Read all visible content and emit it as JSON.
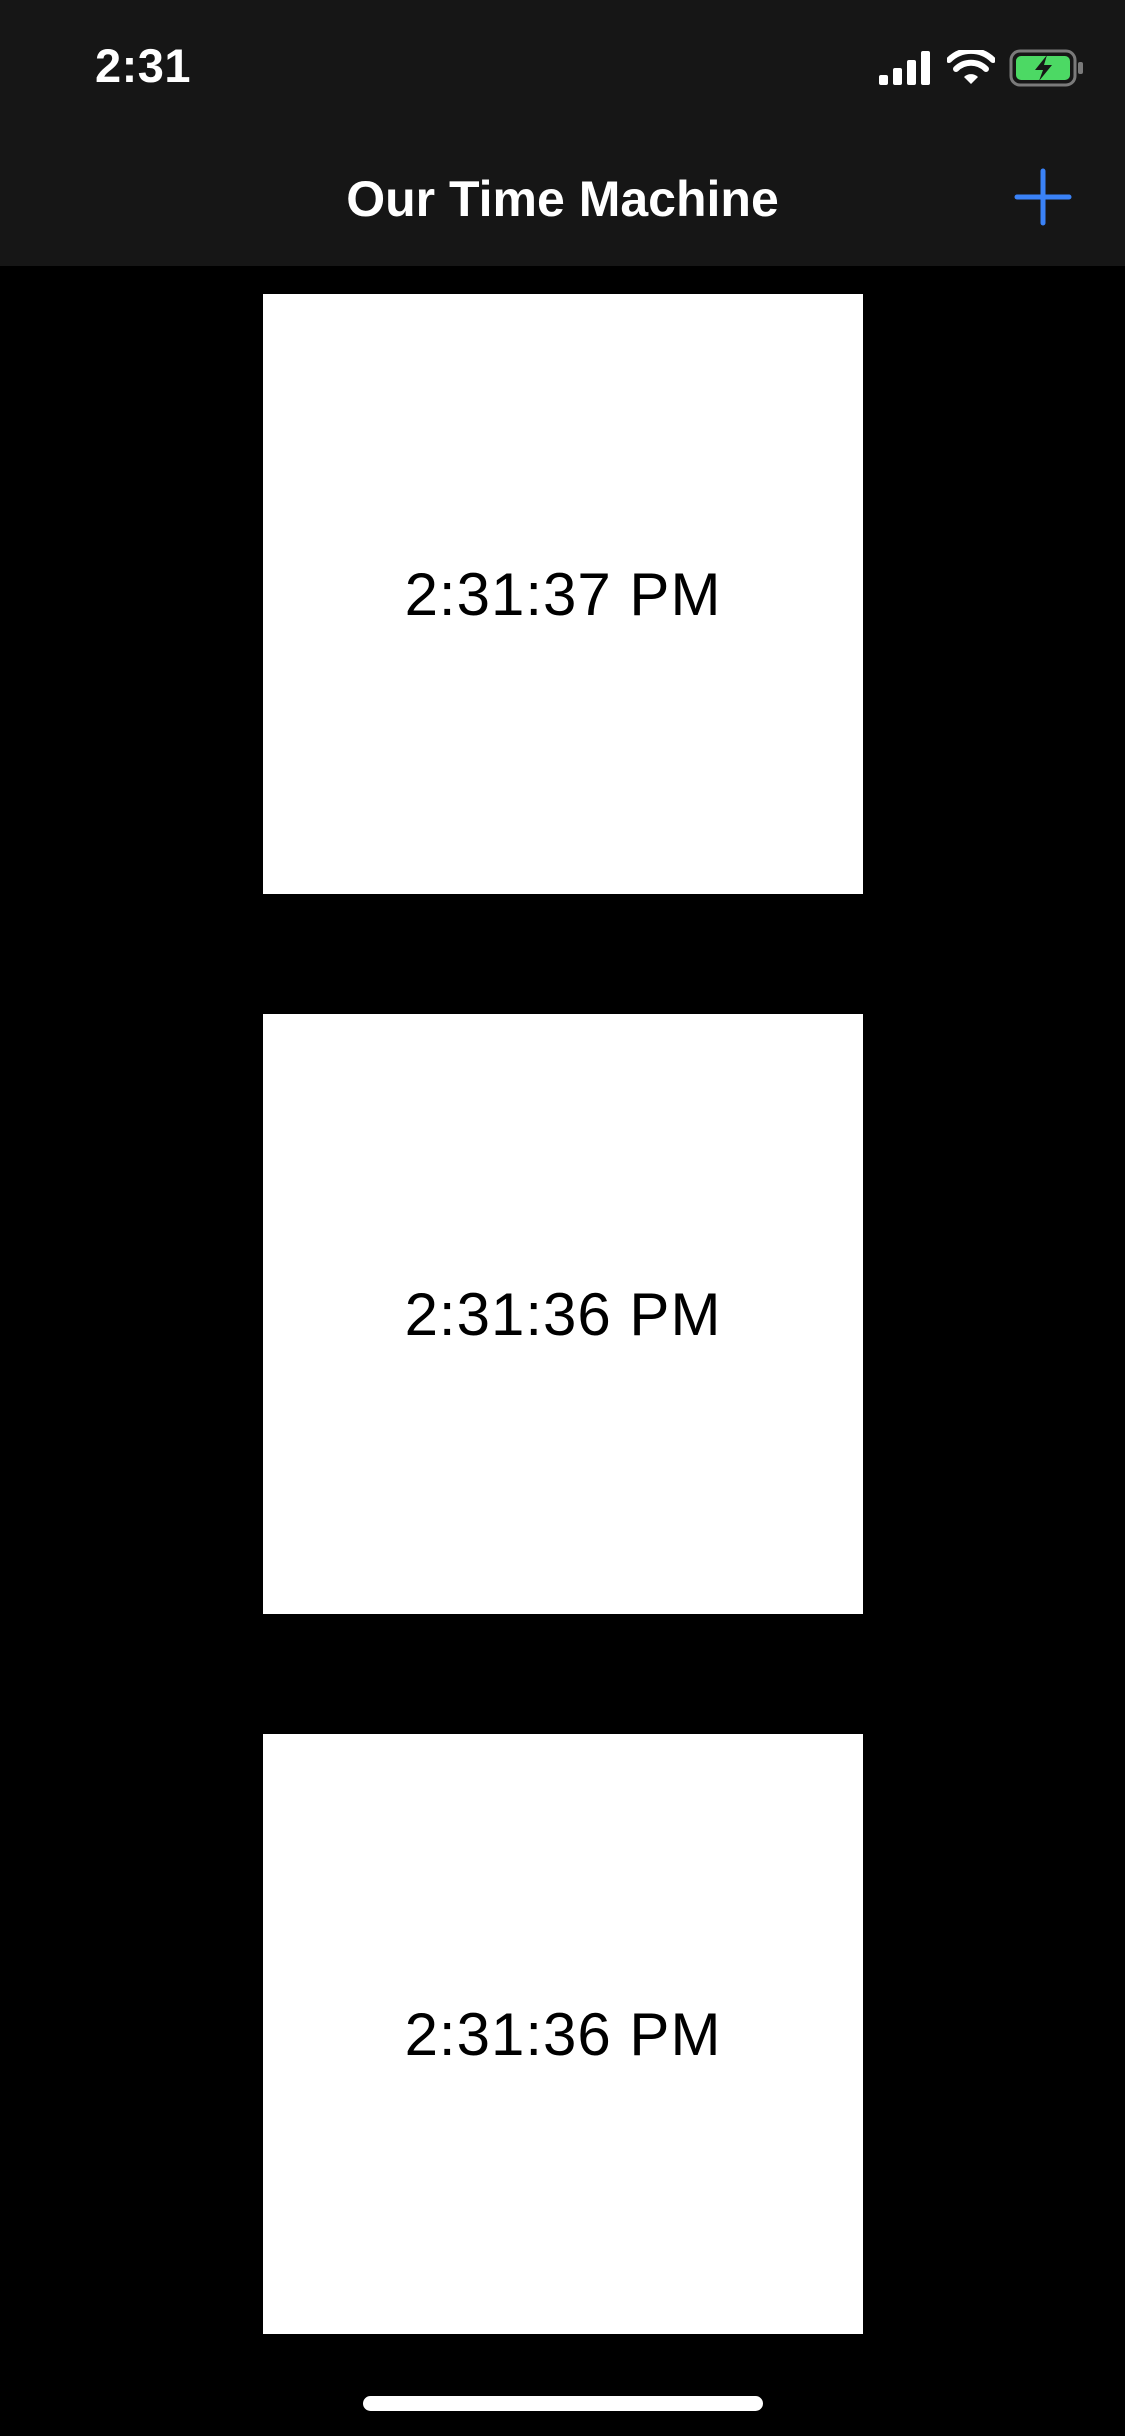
{
  "status_bar": {
    "time": "2:31",
    "icons": [
      "cellular-signal-icon",
      "wifi-icon",
      "battery-charging-icon"
    ],
    "battery_color": "#4cd964"
  },
  "nav": {
    "title": "Our Time Machine",
    "add_button_icon": "plus-icon",
    "accent_color": "#3a82f7"
  },
  "cards": [
    {
      "time": "2:31:37 PM"
    },
    {
      "time": "2:31:36 PM"
    },
    {
      "time": "2:31:36 PM"
    }
  ]
}
